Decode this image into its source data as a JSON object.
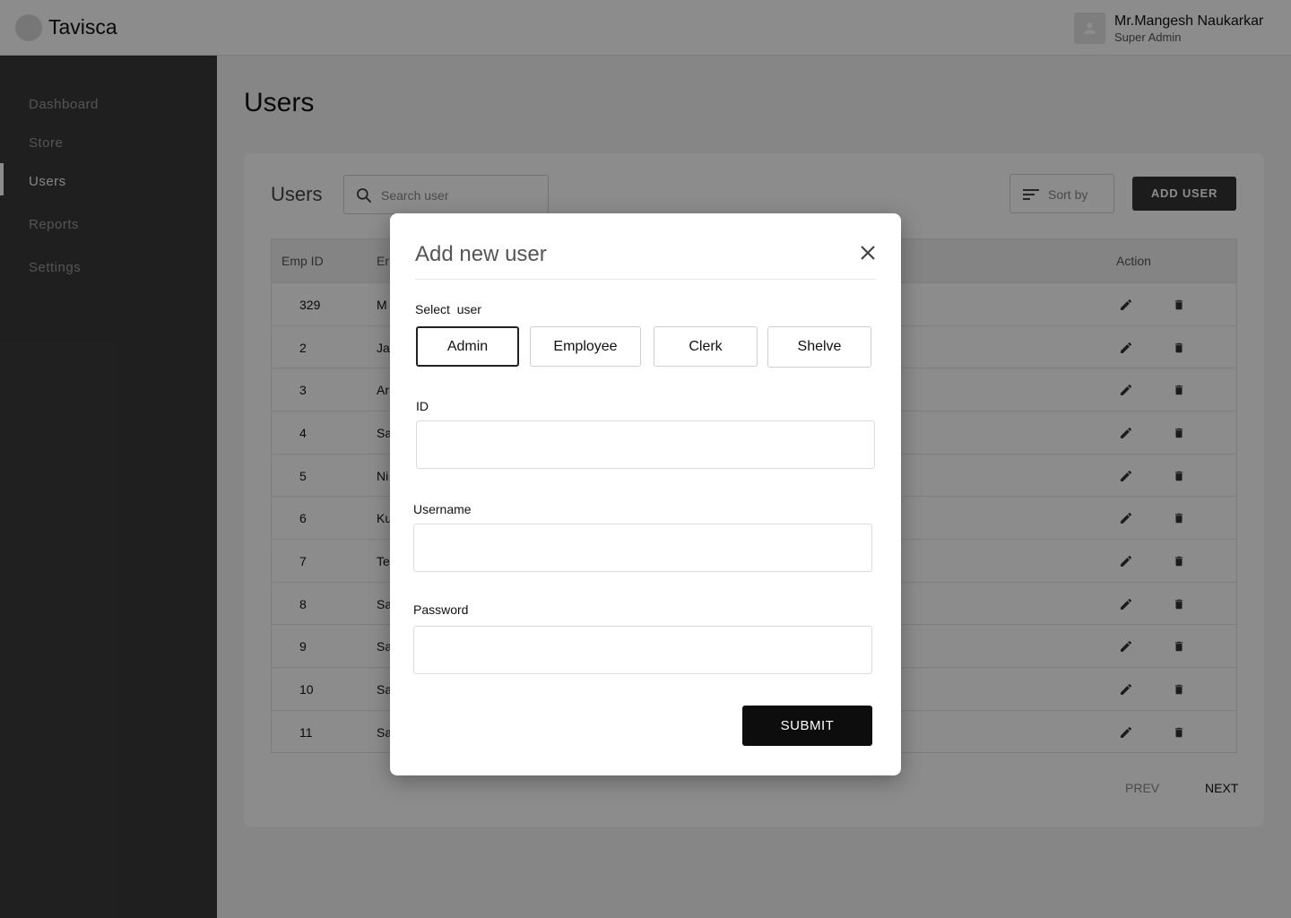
{
  "header": {
    "brand": "Tavisca",
    "user_name": "Mr.Mangesh Naukarkar",
    "user_role": "Super Admin"
  },
  "sidebar": {
    "items": [
      {
        "label": "Dashboard"
      },
      {
        "label": "Store"
      },
      {
        "label": "Users",
        "active": true
      },
      {
        "label": "Reports"
      },
      {
        "label": "Settings"
      }
    ]
  },
  "main": {
    "page_title": "Users",
    "card_title": "Users",
    "search_placeholder": "Search user",
    "sort_label": "Sort by",
    "add_user_label": "ADD USER",
    "columns": [
      "Emp ID",
      "Er",
      "Action"
    ],
    "rows": [
      {
        "id": "329",
        "name": "M"
      },
      {
        "id": "2",
        "name": "Ja"
      },
      {
        "id": "3",
        "name": "Ar"
      },
      {
        "id": "4",
        "name": "Sa"
      },
      {
        "id": "5",
        "name": "Ni"
      },
      {
        "id": "6",
        "name": "Ku"
      },
      {
        "id": "7",
        "name": "Te"
      },
      {
        "id": "8",
        "name": "Sa"
      },
      {
        "id": "9",
        "name": "Sa"
      },
      {
        "id": "10",
        "name": "Sa"
      },
      {
        "id": "11",
        "name": "Sa"
      }
    ],
    "prev_label": "PREV",
    "next_label": "NEXT"
  },
  "modal": {
    "title": "Add new user",
    "select_label": "Select  user",
    "roles": [
      "Admin",
      "Employee",
      "Clerk",
      "Shelve"
    ],
    "selected_role": "Admin",
    "id_label": "ID",
    "username_label": "Username",
    "password_label": "Password",
    "id_value": "",
    "username_value": "",
    "password_value": "",
    "submit_label": "SUBMIT"
  },
  "colors": {
    "sidebar": "#3a3a3a",
    "accent": "#0d0d0d",
    "overlay": "rgba(0,0,0,0.45)"
  }
}
